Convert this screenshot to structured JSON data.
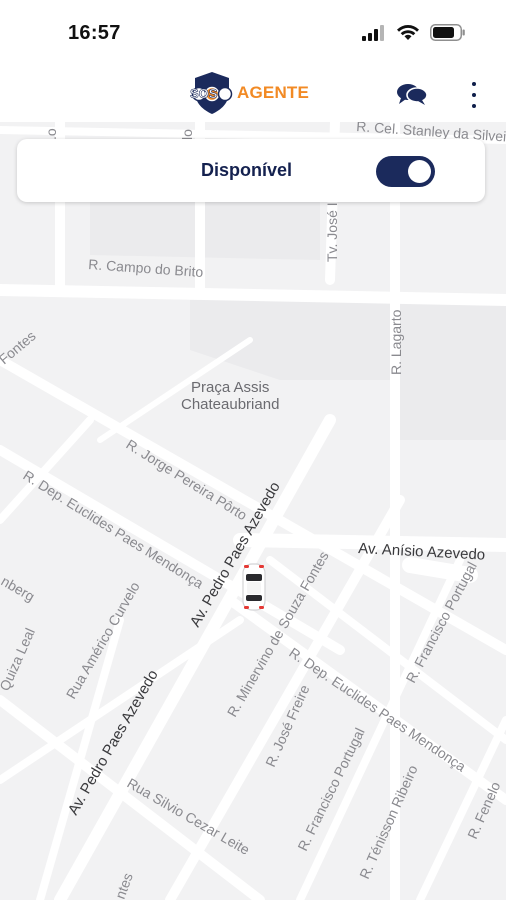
{
  "status_bar": {
    "time": "16:57"
  },
  "header": {
    "logo_text_left": "SOS",
    "logo_text_right": "AGENTE",
    "brand_color": "#f28a24",
    "navy_color": "#1b2a5c",
    "chat_icon": "chat-bubbles-icon",
    "menu_icon": "more-vertical-icon"
  },
  "availability": {
    "label": "Disponível",
    "toggle_on": true
  },
  "map": {
    "street_labels": [
      "R. Cel. Stanley da Silveira",
      "R. Campo do Brito",
      "Tv. José I",
      "R. Lagarto",
      "Fontes",
      "R. Jorge Pereira Pôrto",
      "R. Dep. Euclides Paes Mendonça",
      "Av. Pedro Paes Azevedo",
      "Av. Anísio Azevedo",
      "Rua Américo Curvelo",
      "R. Minervino de Souza Fontes",
      "R. Dep. Euclides Paes Mendonça",
      "R. Francisco Portugal",
      "R. José Freire",
      "R. Francisco Portugal",
      "Av. Pedro Paes Azevedo",
      "Rua Silvio Cezar Leite",
      "R. Ténisson Ribeiro",
      "R. Fenelo",
      "Quiza Leal",
      "nberg",
      "ntes"
    ],
    "poi_label_line1": "Praça Assis",
    "poi_label_line2": "Chateaubriand",
    "marker_icon": "car-icon"
  }
}
